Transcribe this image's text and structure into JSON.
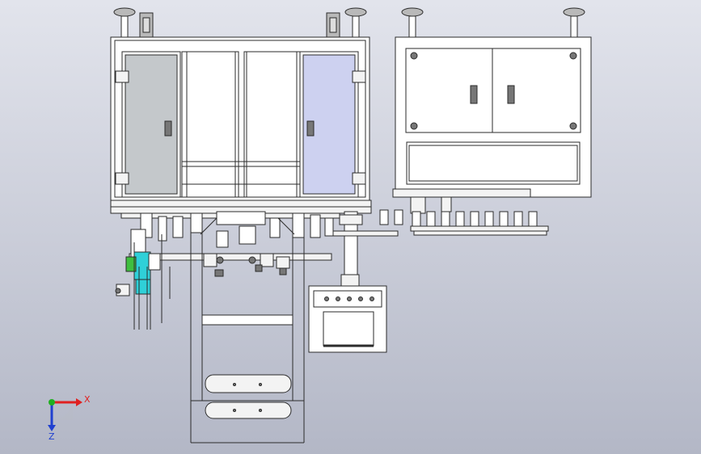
{
  "viewport": {
    "background": "#d3d6e0",
    "colors": {
      "door_left_glass": "#c4c8cb",
      "door_right_glass": "#cdd1f0",
      "roller_green": "#3fbf3f",
      "roller_cyan": "#2fd0d8",
      "axis_x": "#e02020",
      "axis_y": "#20b020",
      "axis_z": "#2040d0"
    }
  },
  "triad": {
    "x_label": "X",
    "z_label": "Z",
    "icons": [
      "axis-x-arrow-icon",
      "axis-y-dot-icon",
      "axis-z-arrow-icon"
    ]
  }
}
